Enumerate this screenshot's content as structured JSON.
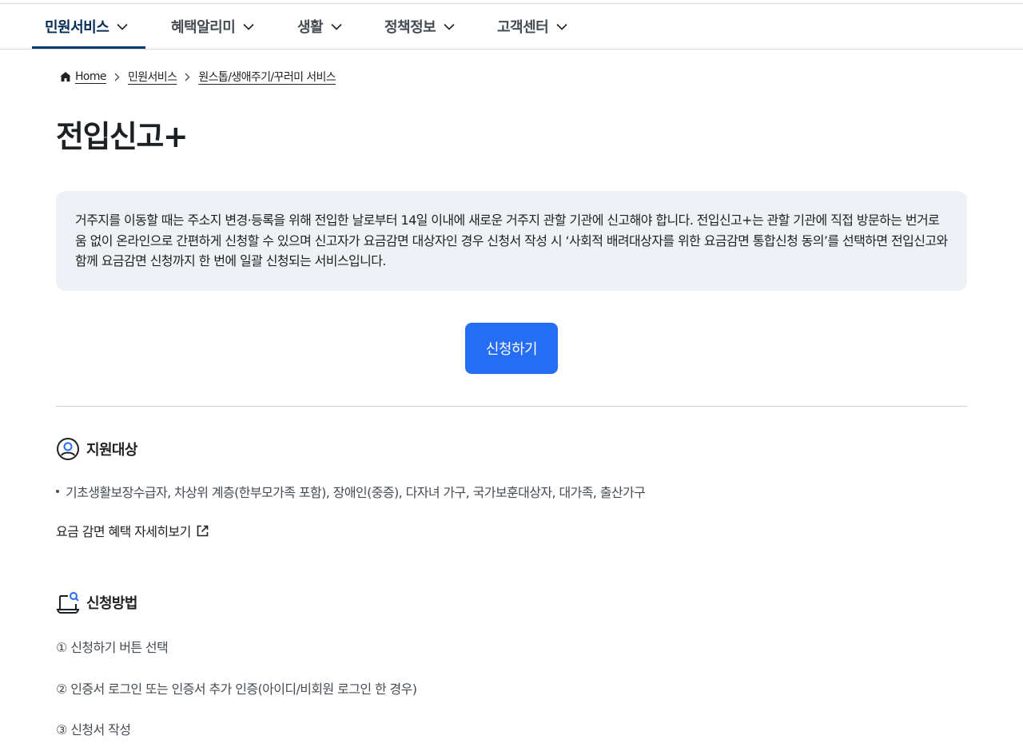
{
  "gnb": {
    "items": [
      {
        "label": "민원서비스",
        "active": true
      },
      {
        "label": "혜택알리미",
        "active": false
      },
      {
        "label": "생활",
        "active": false
      },
      {
        "label": "정책정보",
        "active": false
      },
      {
        "label": "고객센터",
        "active": false
      }
    ]
  },
  "breadcrumb": {
    "home": "Home",
    "level1": "민원서비스",
    "level2": "원스톱/생애주기/꾸러미 서비스"
  },
  "page": {
    "title": "전입신고+",
    "intro": "거주지를 이동할 때는 주소지 변경·등록을 위해 전입한 날로부터 14일 이내에 새로운 거주지 관할 기관에 신고해야 합니다. 전입신고+는 관할 기관에 직접 방문하는 번거로움 없이 온라인으로 간편하게 신청할 수 있으며 신고자가 요금감면 대상자인 경우 신청서 작성 시 ‘사회적 배려대상자를 위한 요금감면 통합신청 동의’를 선택하면 전입신고와 함께 요금감면 신청까지 한 번에 일괄 신청되는 서비스입니다.",
    "apply_label": "신청하기"
  },
  "support": {
    "heading": "지원대상",
    "items": [
      "기초생활보장수급자, 차상위 계층(한부모가족 포함), 장애인(중증), 다자녀 가구, 국가보훈대상자, 대가족, 출산가구"
    ],
    "detail_link": "요금 감면 혜택 자세히보기"
  },
  "method": {
    "heading": "신청방법",
    "steps": [
      "① 신청하기 버튼 선택",
      "② 인증서 로그인 또는 인증서 추가 인증(아이디/비회원 로그인 한 경우)",
      "③ 신청서 작성"
    ]
  },
  "colors": {
    "primary": "#256ef4",
    "nav_active": "#052b57",
    "intro_bg": "#eef1f5"
  }
}
